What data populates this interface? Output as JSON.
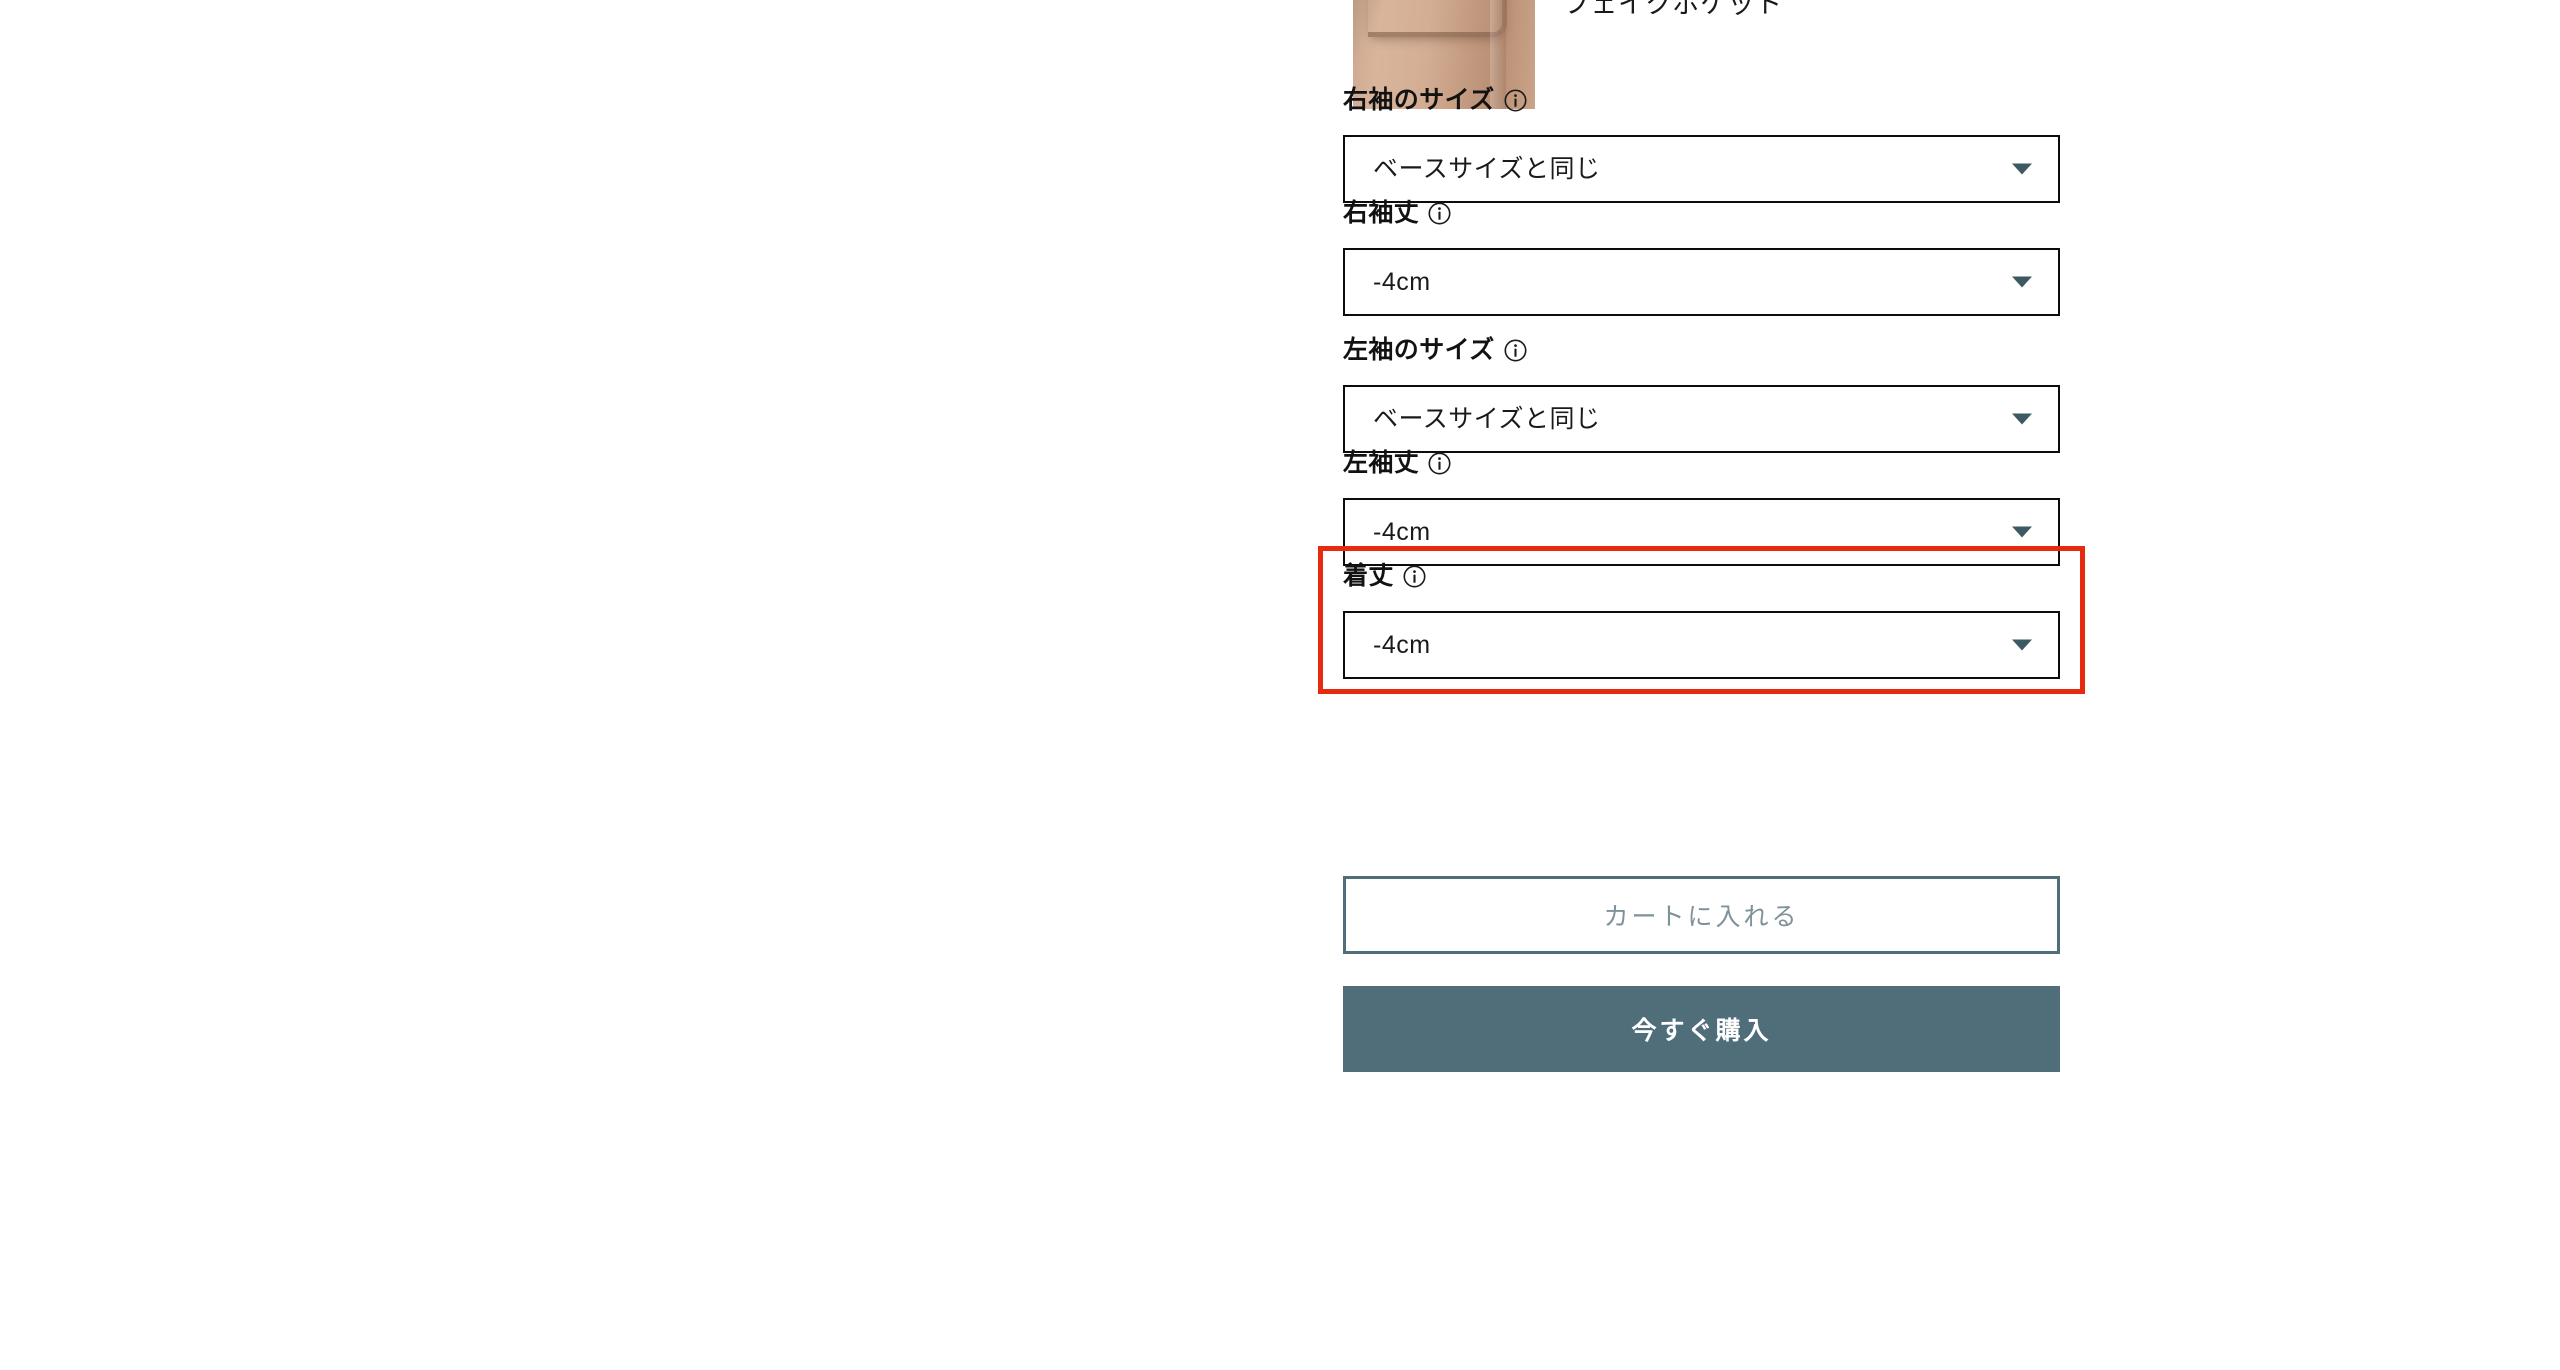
{
  "product_option": {
    "thumbnail_name": "coat-sleeve-pocket-thumbnail",
    "label": "フェイクポケット"
  },
  "colors": {
    "accent_teal": "#4f6e7a",
    "caret_teal": "#3d5a63",
    "highlight_red": "#e62a10",
    "border_black": "#0c0c0c",
    "secondary_btn_text": "#7d929b"
  },
  "fields": [
    {
      "id": "f-right-sleeve-size",
      "name": "right-sleeve-size",
      "label": "右袖のサイズ",
      "info_icon": "info-circle-icon",
      "value": "ベースサイズと同じ",
      "highlighted": false
    },
    {
      "id": "f-right-sleeve-length",
      "name": "right-sleeve-length",
      "label": "右袖丈",
      "info_icon": "info-circle-icon",
      "value": "-4cm",
      "highlighted": false
    },
    {
      "id": "f-left-sleeve-size",
      "name": "left-sleeve-size",
      "label": "左袖のサイズ",
      "info_icon": "info-circle-icon",
      "value": "ベースサイズと同じ",
      "highlighted": false
    },
    {
      "id": "f-left-sleeve-length",
      "name": "left-sleeve-length",
      "label": "左袖丈",
      "info_icon": "info-circle-icon",
      "value": "-4cm",
      "highlighted": false
    },
    {
      "id": "f-body-length",
      "name": "body-length",
      "label": "着丈",
      "info_icon": "info-circle-icon",
      "value": "-4cm",
      "highlighted": true
    }
  ],
  "actions": {
    "add_to_cart_label": "カートに入れる",
    "buy_now_label": "今すぐ購入"
  }
}
